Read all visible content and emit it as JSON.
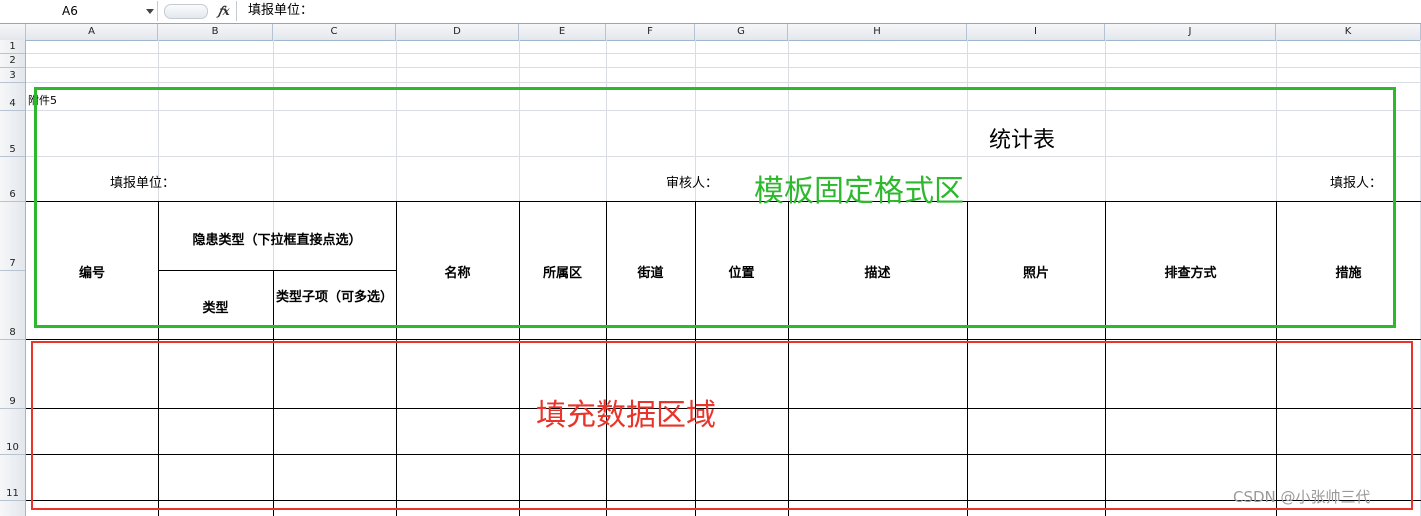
{
  "formula_bar": {
    "name_box": "A6",
    "fx_icon": "fx-icon",
    "formula": "填报单位："
  },
  "columns": [
    "A",
    "B",
    "C",
    "D",
    "E",
    "F",
    "G",
    "H",
    "I",
    "J",
    "K"
  ],
  "rows": [
    "1",
    "2",
    "3",
    "4",
    "5",
    "6",
    "7",
    "8",
    "9",
    "10",
    "11"
  ],
  "sheet": {
    "attachment": "附件5",
    "title": "统计表",
    "reporting_unit_label": "填报单位：",
    "reviewer_label": "审核人：",
    "filler_label": "填报人：",
    "headers": {
      "number": "编号",
      "hazard_type": "隐患类型（下拉框直接点选）",
      "type": "类型",
      "subtype": "类型子项（可多选）",
      "name": "名称",
      "district": "所属区",
      "street": "街道",
      "location": "位置",
      "description": "描述",
      "photo": "照片",
      "inspection_method": "排查方式",
      "measures": "措施"
    }
  },
  "annotations": {
    "template_area": "模板固定格式区",
    "fill_area": "填充数据区域",
    "template_color": "#2eb82e",
    "fill_color": "#e8342a"
  },
  "watermark": "CSDN @小张帅三代"
}
